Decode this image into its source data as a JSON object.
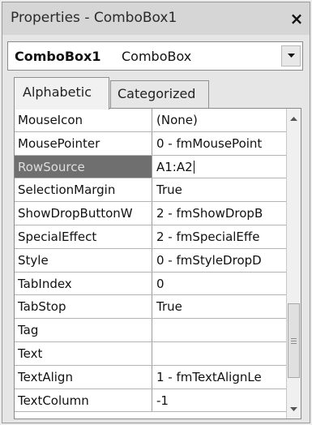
{
  "window": {
    "title": "Properties - ComboBox1",
    "close_glyph": "×"
  },
  "object_selector": {
    "name": "ComboBox1",
    "type": "ComboBox"
  },
  "tabs": [
    {
      "label": "Alphabetic",
      "active": true
    },
    {
      "label": "Categorized",
      "active": false
    }
  ],
  "properties": [
    {
      "name": "MouseIcon",
      "value": "(None)"
    },
    {
      "name": "MousePointer",
      "value": "0 - fmMousePoint"
    },
    {
      "name": "RowSource",
      "value": "A1:A2",
      "selected": true
    },
    {
      "name": "SelectionMargin",
      "value": "True"
    },
    {
      "name": "ShowDropButtonW",
      "value": "2 - fmShowDropB"
    },
    {
      "name": "SpecialEffect",
      "value": "2 - fmSpecialEffe"
    },
    {
      "name": "Style",
      "value": "0 - fmStyleDropD"
    },
    {
      "name": "TabIndex",
      "value": "0"
    },
    {
      "name": "TabStop",
      "value": "True"
    },
    {
      "name": "Tag",
      "value": ""
    },
    {
      "name": "Text",
      "value": ""
    },
    {
      "name": "TextAlign",
      "value": "1 - fmTextAlignLe"
    },
    {
      "name": "TextColumn",
      "value": "-1"
    }
  ],
  "icons": {
    "close": "close-icon",
    "dropdown": "chevron-down-icon",
    "scroll_up": "scroll-up-arrow-icon",
    "scroll_down": "scroll-down-arrow-icon"
  },
  "colors": {
    "selected_row": "#6f6f6f",
    "grid_bg": "#ffffff",
    "window_bg": "#e6e6e6"
  }
}
